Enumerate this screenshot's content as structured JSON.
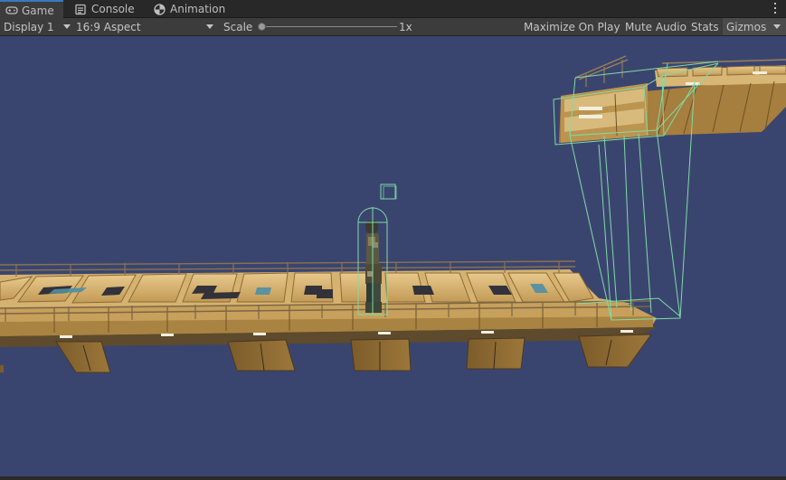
{
  "tabs": [
    {
      "label": "Game",
      "icon": "gamepad-icon",
      "active": true
    },
    {
      "label": "Console",
      "icon": "console-icon",
      "active": false
    },
    {
      "label": "Animation",
      "icon": "animation-icon",
      "active": false
    }
  ],
  "toolbar": {
    "display": "Display 1",
    "aspect": "16:9 Aspect",
    "scale_label": "Scale",
    "scale_value": "1x",
    "scale_level": 0.0,
    "maximize_on_play": "Maximize On Play",
    "mute_audio": "Mute Audio",
    "stats": "Stats",
    "gizmos": "Gizmos"
  },
  "colors": {
    "viewport_bg": "#3a456f",
    "gizmo_green": "#7fdca6",
    "active_tab_accent": "#3a79bb"
  }
}
